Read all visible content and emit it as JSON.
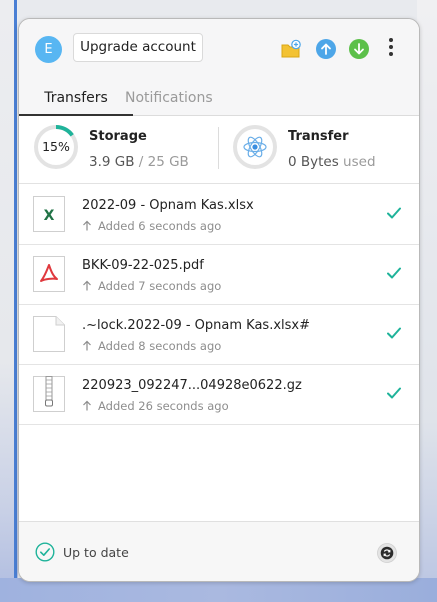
{
  "header": {
    "avatar_letter": "E",
    "upgrade_label": "Upgrade account",
    "icons": [
      "folder-add-icon",
      "upload-icon",
      "download-icon",
      "more-icon"
    ]
  },
  "tabs": [
    {
      "label": "Transfers",
      "active": true
    },
    {
      "label": "Notifications",
      "active": false
    }
  ],
  "storage": {
    "title": "Storage",
    "percent": 15,
    "percent_label": "15%",
    "used": "3.9 GB",
    "separator": " / ",
    "total": "25 GB"
  },
  "transfer": {
    "title": "Transfer",
    "amount": "0 Bytes",
    "suffix": " used"
  },
  "files": [
    {
      "name": "2022-09 - Opnam Kas.xlsx",
      "status": "Added 6 seconds ago",
      "icon": "excel-file-icon"
    },
    {
      "name": "BKK-09-22-025.pdf",
      "status": "Added 7 seconds ago",
      "icon": "pdf-file-icon"
    },
    {
      "name": ".~lock.2022-09 - Opnam Kas.xlsx#",
      "status": "Added 8 seconds ago",
      "icon": "generic-file-icon"
    },
    {
      "name": "220923_092247...04928e0622.gz",
      "status": "Added 26 seconds ago",
      "icon": "archive-file-icon"
    }
  ],
  "footer": {
    "status": "Up to date"
  },
  "colors": {
    "accent": "#1fb39a",
    "upload": "#4da6e8",
    "download": "#5cc04a",
    "excel": "#217346",
    "pdf": "#e0393e"
  }
}
